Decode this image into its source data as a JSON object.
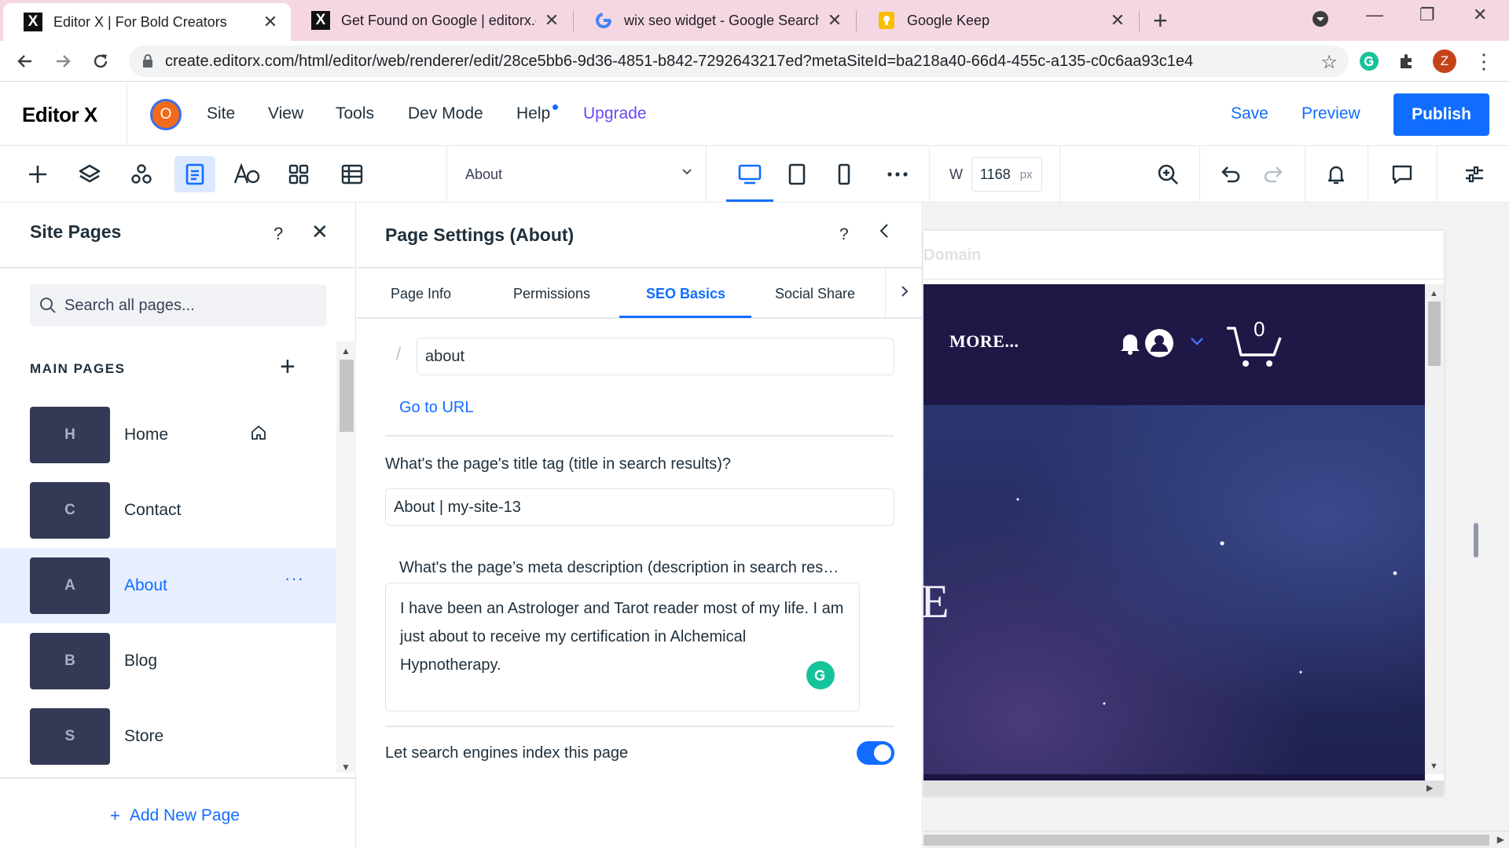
{
  "browser": {
    "tabs": [
      {
        "title": "Editor X | For Bold Creators",
        "active": true,
        "favicon": "editor-x-icon"
      },
      {
        "title": "Get Found on Google | editorx.cc",
        "active": false,
        "favicon": "editor-x-icon"
      },
      {
        "title": "wix seo widget - Google Search",
        "active": false,
        "favicon": "google-icon"
      },
      {
        "title": "Google Keep",
        "active": false,
        "favicon": "google-keep-icon"
      }
    ],
    "url": "create.editorx.com/html/editor/web/renderer/edit/28ce5bb6-9d36-4851-b842-7292643217ed?metaSiteId=ba218a40-66d4-455c-a135-c0c6aa93c1e4",
    "profile_initial": "Z",
    "colors": {
      "tabstrip": "#f5d7e3",
      "profile": "#c5431b"
    }
  },
  "editor": {
    "logo": "Editor X",
    "site_avatar_initial": "O",
    "menu": [
      "Site",
      "View",
      "Tools",
      "Dev Mode",
      "Help"
    ],
    "upgrade": "Upgrade",
    "save": "Save",
    "preview": "Preview",
    "publish": "Publish",
    "accent_color": "#116dff"
  },
  "toolbar": {
    "current_page": "About",
    "width_label": "W",
    "width_value": "1168",
    "width_unit": "px",
    "active_device": "desktop"
  },
  "pages_panel": {
    "title": "Site Pages",
    "help": "?",
    "search_placeholder": "Search all pages...",
    "section_title": "MAIN PAGES",
    "pages": [
      {
        "initial": "H",
        "name": "Home",
        "is_home": true,
        "selected": false
      },
      {
        "initial": "C",
        "name": "Contact",
        "is_home": false,
        "selected": false
      },
      {
        "initial": "A",
        "name": "About",
        "is_home": false,
        "selected": true
      },
      {
        "initial": "B",
        "name": "Blog",
        "is_home": false,
        "selected": false
      },
      {
        "initial": "S",
        "name": "Store",
        "is_home": false,
        "selected": false
      }
    ],
    "add_new_page": "Add New Page"
  },
  "page_settings": {
    "title": "Page Settings (About)",
    "help": "?",
    "tabs": [
      "Page Info",
      "Permissions",
      "SEO Basics",
      "Social Share"
    ],
    "active_tab": "SEO Basics",
    "url_slug": "about",
    "slash": "/",
    "go_to_url": "Go to URL",
    "title_tag_label": "What's the page's title tag (title in search results)?",
    "title_tag_value": "About | my-site-13",
    "meta_description_label": "What's the page’s meta description (description in search res…",
    "meta_description_value": "I have been an Astrologer and Tarot reader most of my life. I am just about to receive my certification in Alchemical Hypnotherapy.",
    "index_label": "Let search engines index this page",
    "index_enabled": true
  },
  "canvas": {
    "domain_text": "Domain",
    "nav_more": "MORE...",
    "cart_count": "0",
    "hero_letter": "E",
    "header_color": "#1d1845"
  }
}
